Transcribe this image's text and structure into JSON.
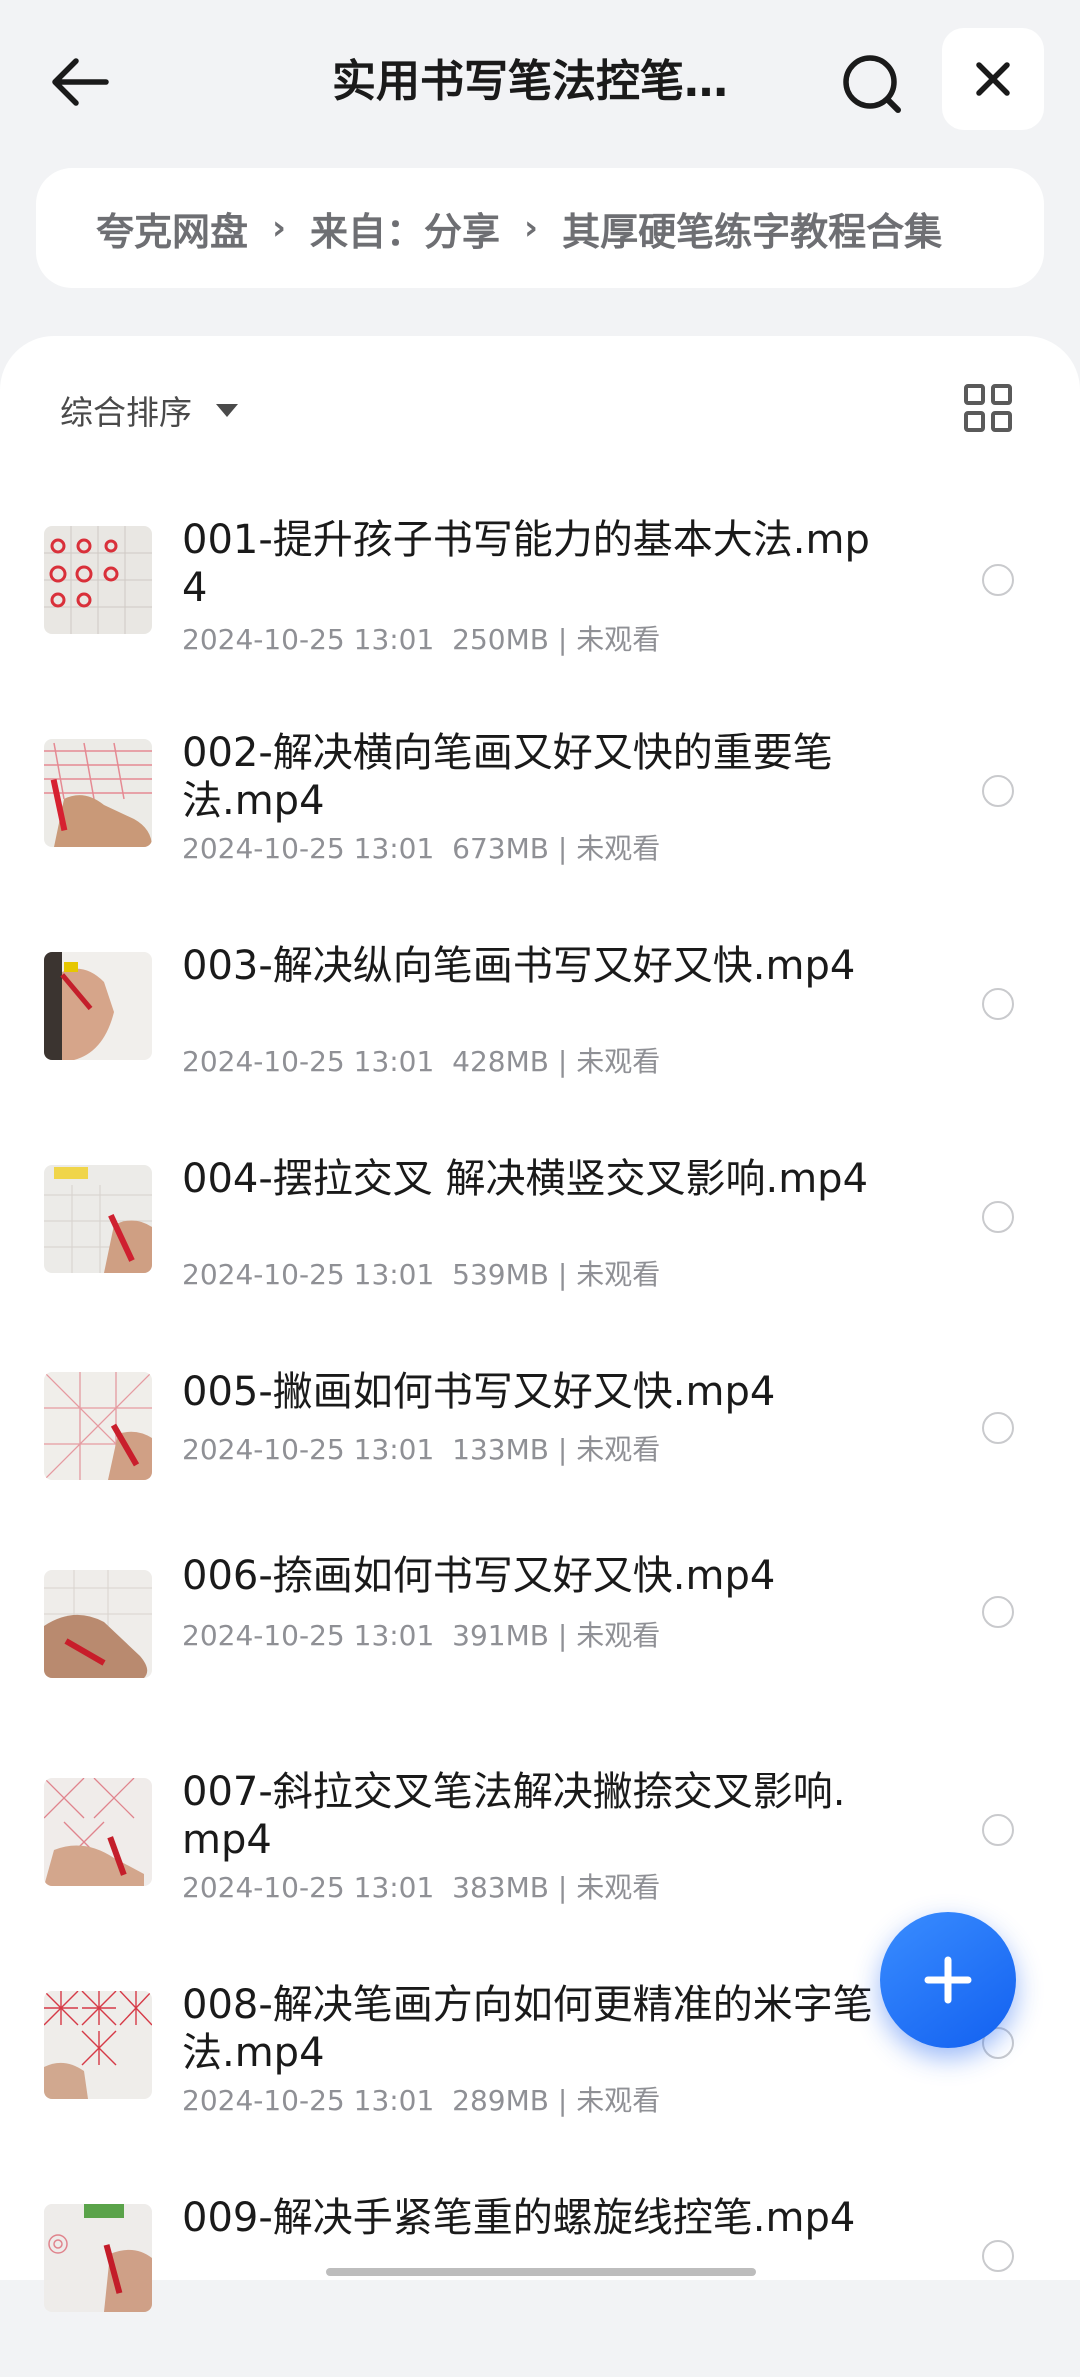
{
  "header": {
    "title": "实用书写笔法控笔…",
    "icons": {
      "back": "arrow-left-icon",
      "search": "search-icon",
      "close": "close-icon"
    }
  },
  "breadcrumb": {
    "items": [
      "夸克网盘",
      "来自：分享",
      "其厚硬笔练字教程合集"
    ]
  },
  "toolbar": {
    "sort_label": "综合排序",
    "view_icon": "grid-view-icon"
  },
  "files": [
    {
      "name": "001-提升孩子书写能力的基本大法.mp4",
      "date": "2024-10-25 13:01",
      "size": "250MB",
      "status": "未观看"
    },
    {
      "name": "002-解决横向笔画又好又快的重要笔法.mp4",
      "date": "2024-10-25 13:01",
      "size": "673MB",
      "status": "未观看"
    },
    {
      "name": "003-解决纵向笔画书写又好又快.mp4",
      "date": "2024-10-25 13:01",
      "size": "428MB",
      "status": "未观看"
    },
    {
      "name": "004-摆拉交叉  解决横竖交叉影响.mp4",
      "date": "2024-10-25 13:01",
      "size": "539MB",
      "status": "未观看"
    },
    {
      "name": "005-撇画如何书写又好又快.mp4",
      "date": "2024-10-25 13:01",
      "size": "133MB",
      "status": "未观看"
    },
    {
      "name": "006-捺画如何书写又好又快.mp4",
      "date": "2024-10-25 13:01",
      "size": "391MB",
      "status": "未观看"
    },
    {
      "name": "007-斜拉交叉笔法解决撇捺交叉影响.mp4",
      "date": "2024-10-25 13:01",
      "size": "383MB",
      "status": "未观看"
    },
    {
      "name": "008-解决笔画方向如何更精准的米字笔法.mp4",
      "date": "2024-10-25 13:01",
      "size": "289MB",
      "status": "未观看"
    },
    {
      "name": "009-解决手紧笔重的螺旋线控笔.mp4"
    }
  ],
  "fab": {
    "icon": "plus-icon"
  },
  "colors": {
    "accent": "#1a6ef5",
    "background": "#f2f3f5",
    "meta_text": "#8f9095"
  }
}
